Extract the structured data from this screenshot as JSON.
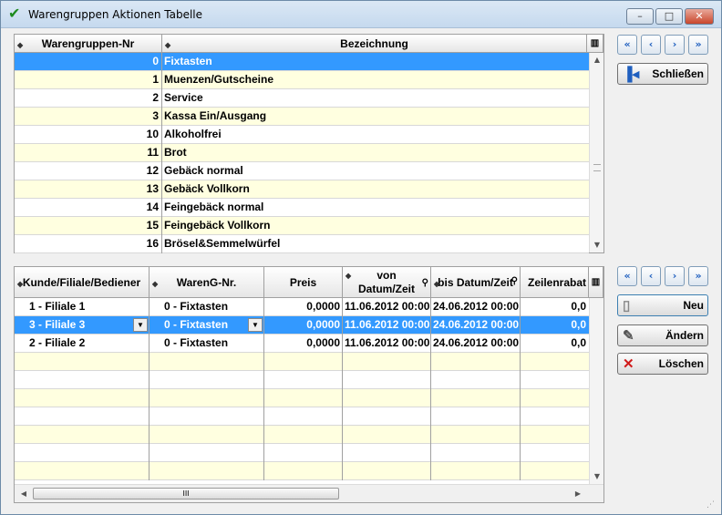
{
  "window": {
    "title": "Warengruppen Aktionen Tabelle",
    "minimize_label": "–",
    "maximize_label": "□",
    "close_label": "✕"
  },
  "top_table": {
    "columns": [
      "Warengruppen-Nr",
      "Bezeichnung"
    ],
    "rows": [
      {
        "nr": "0",
        "bez": "Fixtasten"
      },
      {
        "nr": "1",
        "bez": "Muenzen/Gutscheine"
      },
      {
        "nr": "2",
        "bez": "Service"
      },
      {
        "nr": "3",
        "bez": "Kassa Ein/Ausgang"
      },
      {
        "nr": "10",
        "bez": "Alkoholfrei"
      },
      {
        "nr": "11",
        "bez": "Brot"
      },
      {
        "nr": "12",
        "bez": "Gebäck normal"
      },
      {
        "nr": "13",
        "bez": "Gebäck Vollkorn"
      },
      {
        "nr": "14",
        "bez": "Feingebäck normal"
      },
      {
        "nr": "15",
        "bez": "Feingebäck Vollkorn"
      },
      {
        "nr": "16",
        "bez": "Brösel&Semmelwürfel"
      }
    ]
  },
  "bottom_table": {
    "columns": {
      "kunde": "Kunde/Filiale/Bediener",
      "wareng": "WarenG-Nr.",
      "preis": "Preis",
      "von_line1": "von",
      "von_line2": "Datum/Zeit",
      "bis": "bis Datum/Zeit",
      "rabatt": "Zeilenrabat"
    },
    "rows": [
      {
        "kunde": "1 - Filiale 1",
        "wareng": "0 - Fixtasten",
        "preis": "0,0000",
        "von": "11.06.2012 00:00",
        "bis": "24.06.2012 00:00",
        "rabatt": "0,0"
      },
      {
        "kunde": "3 - Filiale 3",
        "wareng": "0 - Fixtasten",
        "preis": "0,0000",
        "von": "11.06.2012 00:00",
        "bis": "24.06.2012 00:00",
        "rabatt": "0,0"
      },
      {
        "kunde": "2 - Filiale 2",
        "wareng": "0 - Fixtasten",
        "preis": "0,0000",
        "von": "11.06.2012 00:00",
        "bis": "24.06.2012 00:00",
        "rabatt": "0,0"
      }
    ],
    "hscroll_grip": "III"
  },
  "buttons": {
    "schliessen": "Schließen",
    "neu": "Neu",
    "aendern": "Ändern",
    "loeschen": "Löschen"
  },
  "nav": {
    "first": "«",
    "prev": "‹",
    "next": "›",
    "last": "»"
  }
}
